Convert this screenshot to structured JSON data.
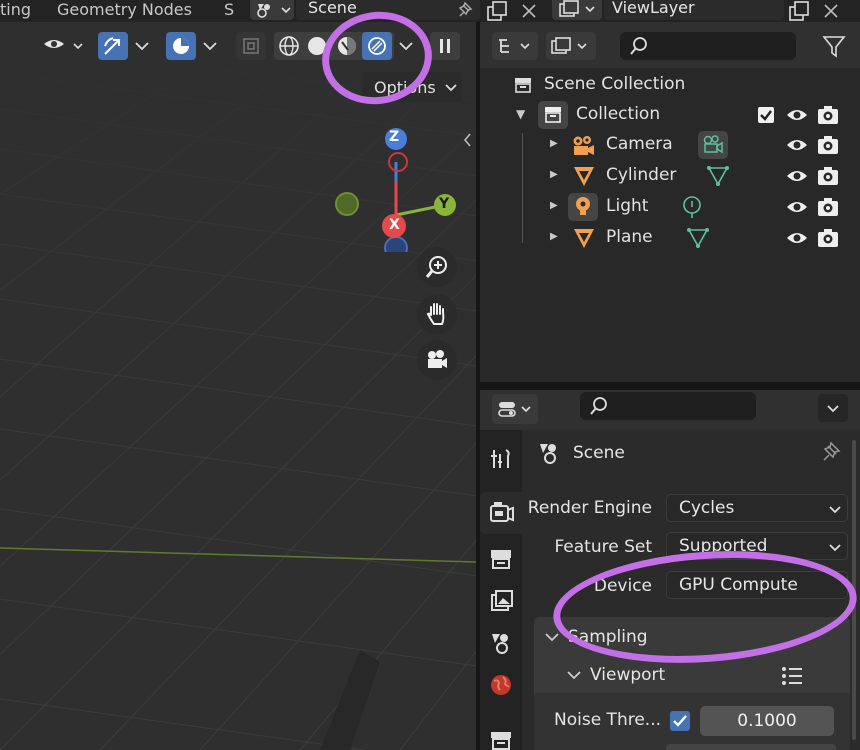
{
  "topbar": {
    "tabs": [
      "ting",
      "Geometry Nodes",
      "S"
    ],
    "scene_name": "Scene",
    "view_layer": "ViewLayer"
  },
  "viewport": {
    "options_label": "Options",
    "gizmo": {
      "z": "Z",
      "y": "Y",
      "x": "X"
    }
  },
  "outliner": {
    "root": "Scene Collection",
    "collection": "Collection",
    "items": [
      {
        "label": "Camera",
        "icon": "camera-object-icon",
        "data_icon": "camera-data-icon"
      },
      {
        "label": "Cylinder",
        "icon": "mesh-object-icon",
        "data_icon": "mesh-data-icon"
      },
      {
        "label": "Light",
        "icon": "light-object-icon",
        "data_icon": "light-data-icon"
      },
      {
        "label": "Plane",
        "icon": "mesh-object-icon",
        "data_icon": "mesh-data-icon"
      }
    ]
  },
  "properties": {
    "context_title": "Scene",
    "fields": {
      "render_engine_label": "Render Engine",
      "render_engine_value": "Cycles",
      "feature_set_label": "Feature Set",
      "feature_set_value": "Supported",
      "device_label": "Device",
      "device_value": "GPU Compute"
    },
    "sampling_label": "Sampling",
    "viewport_label": "Viewport",
    "noise_threshold_label": "Noise Thre...",
    "noise_threshold_enabled": true,
    "noise_threshold_value": "0.1000"
  },
  "colors": {
    "accent_blue": "#4772b3",
    "annotation_purple": "#c36fe6",
    "axis_x": "#e5484d",
    "axis_y": "#8ab43a",
    "axis_z": "#4a7ed8"
  }
}
